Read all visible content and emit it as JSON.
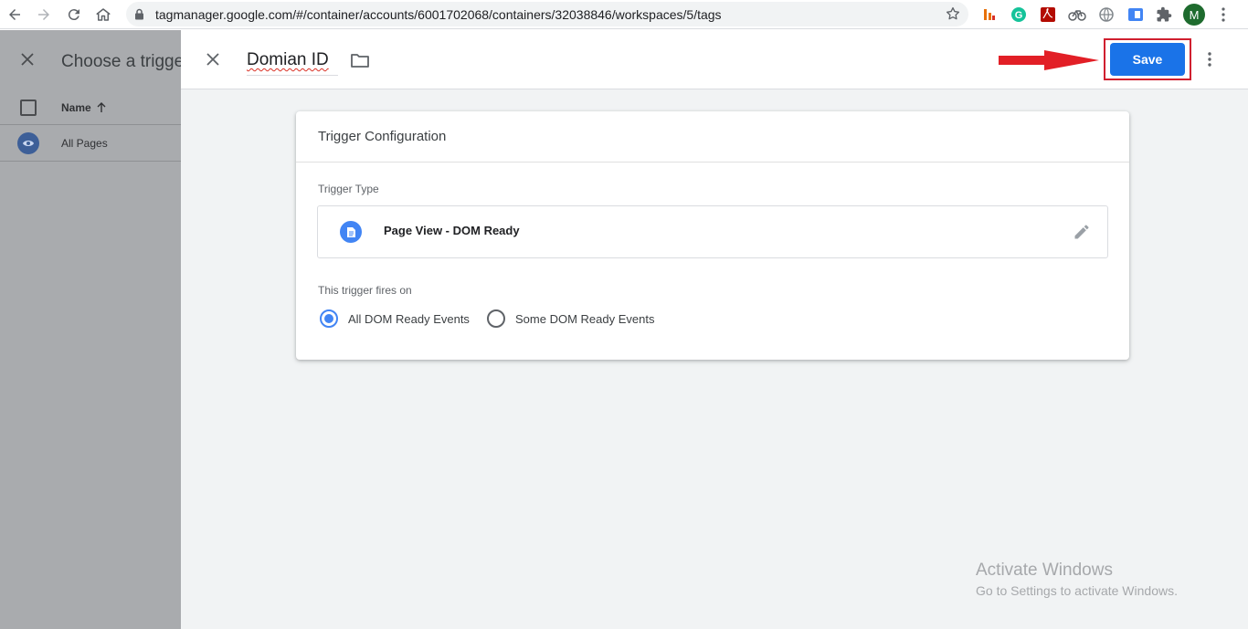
{
  "browser": {
    "url": "tagmanager.google.com/#/container/accounts/6001702068/containers/32038846/workspaces/5/tags",
    "profile_initial": "M",
    "icons": [
      "back-icon",
      "forward-icon",
      "reload-icon",
      "home-icon",
      "lock-icon",
      "bookmark-star-icon"
    ],
    "extensions": [
      "bar-chart-extension-icon",
      "grammarly-icon",
      "pdf-icon",
      "bike-icon",
      "globe-icon",
      "window-icon",
      "puzzle-icon",
      "kebab-menu-icon"
    ]
  },
  "left_panel": {
    "title": "Choose a trigger",
    "column_name": "Name",
    "rows": [
      {
        "label": "All Pages"
      }
    ]
  },
  "header": {
    "tag_name": "Domian ID",
    "save_label": "Save"
  },
  "card": {
    "title": "Trigger Configuration",
    "trigger_type_label": "Trigger Type",
    "trigger_type_value": "Page View - DOM Ready",
    "fires_on_label": "This trigger fires on",
    "options": [
      {
        "label": "All DOM Ready Events",
        "selected": true
      },
      {
        "label": "Some DOM Ready Events",
        "selected": false
      }
    ]
  },
  "watermark": {
    "line1": "Activate Windows",
    "line2": "Go to Settings to activate Windows."
  },
  "colors": {
    "accent": "#1a73e8",
    "annotation_red": "#d01f2f",
    "radio_blue": "#4285f4"
  }
}
